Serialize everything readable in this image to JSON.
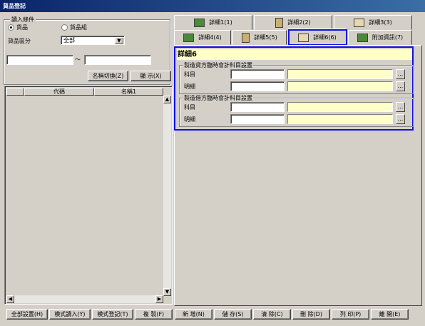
{
  "window": {
    "title": "貨品登記"
  },
  "left": {
    "condition_group": "讀入條件",
    "radio_goods": "貨品",
    "radio_goods_group": "貨品組",
    "category_label": "貨品區分",
    "category_value": "全部",
    "range_from_value": "",
    "range_tilde": "～",
    "range_to_value": "",
    "name_switch_button": "名稱切換(Z)",
    "show_button": "顯 示(X)",
    "list_columns": [
      "代碼",
      "名稱1"
    ]
  },
  "tabs": {
    "row1": [
      {
        "label": "詳細1(1)",
        "icon": "book-icon"
      },
      {
        "label": "詳細2(2)",
        "icon": "notebook-icon"
      },
      {
        "label": "詳細3(3)",
        "icon": "card-icon"
      }
    ],
    "row2": [
      {
        "label": "詳細4(4)",
        "icon": "book-icon"
      },
      {
        "label": "詳細5(5)",
        "icon": "notebook-icon"
      },
      {
        "label": "詳細6(6)",
        "icon": "card-icon"
      },
      {
        "label": "附加資訊(7)",
        "icon": "book-icon"
      }
    ],
    "active": "詳細6(6)"
  },
  "detail6": {
    "title": "詳細6",
    "credit_group": {
      "title": "製造貸方臨時會計科目設置",
      "subject_label": "科目",
      "detail_label": "明細",
      "subject_code": "",
      "subject_name": "",
      "detail_code": "",
      "detail_name": ""
    },
    "debit_group": {
      "title": "製造借方臨時會計科目設置",
      "subject_label": "科目",
      "detail_label": "明細",
      "subject_code": "",
      "subject_name": "",
      "detail_code": "",
      "detail_name": ""
    },
    "lookup_button": "..."
  },
  "bottom_buttons": [
    "全部設置(H)",
    "模式讀入(Y)",
    "模式登記(T)",
    "複 製(F)",
    "新 增(N)",
    "儲 存(S)",
    "清 除(C)",
    "刪 除(D)",
    "列 印(P)",
    "離 開(E)"
  ],
  "colors": {
    "title_bar": "#0a246a",
    "highlight_field": "#ffffc8",
    "selection_border": "#1010e8"
  }
}
